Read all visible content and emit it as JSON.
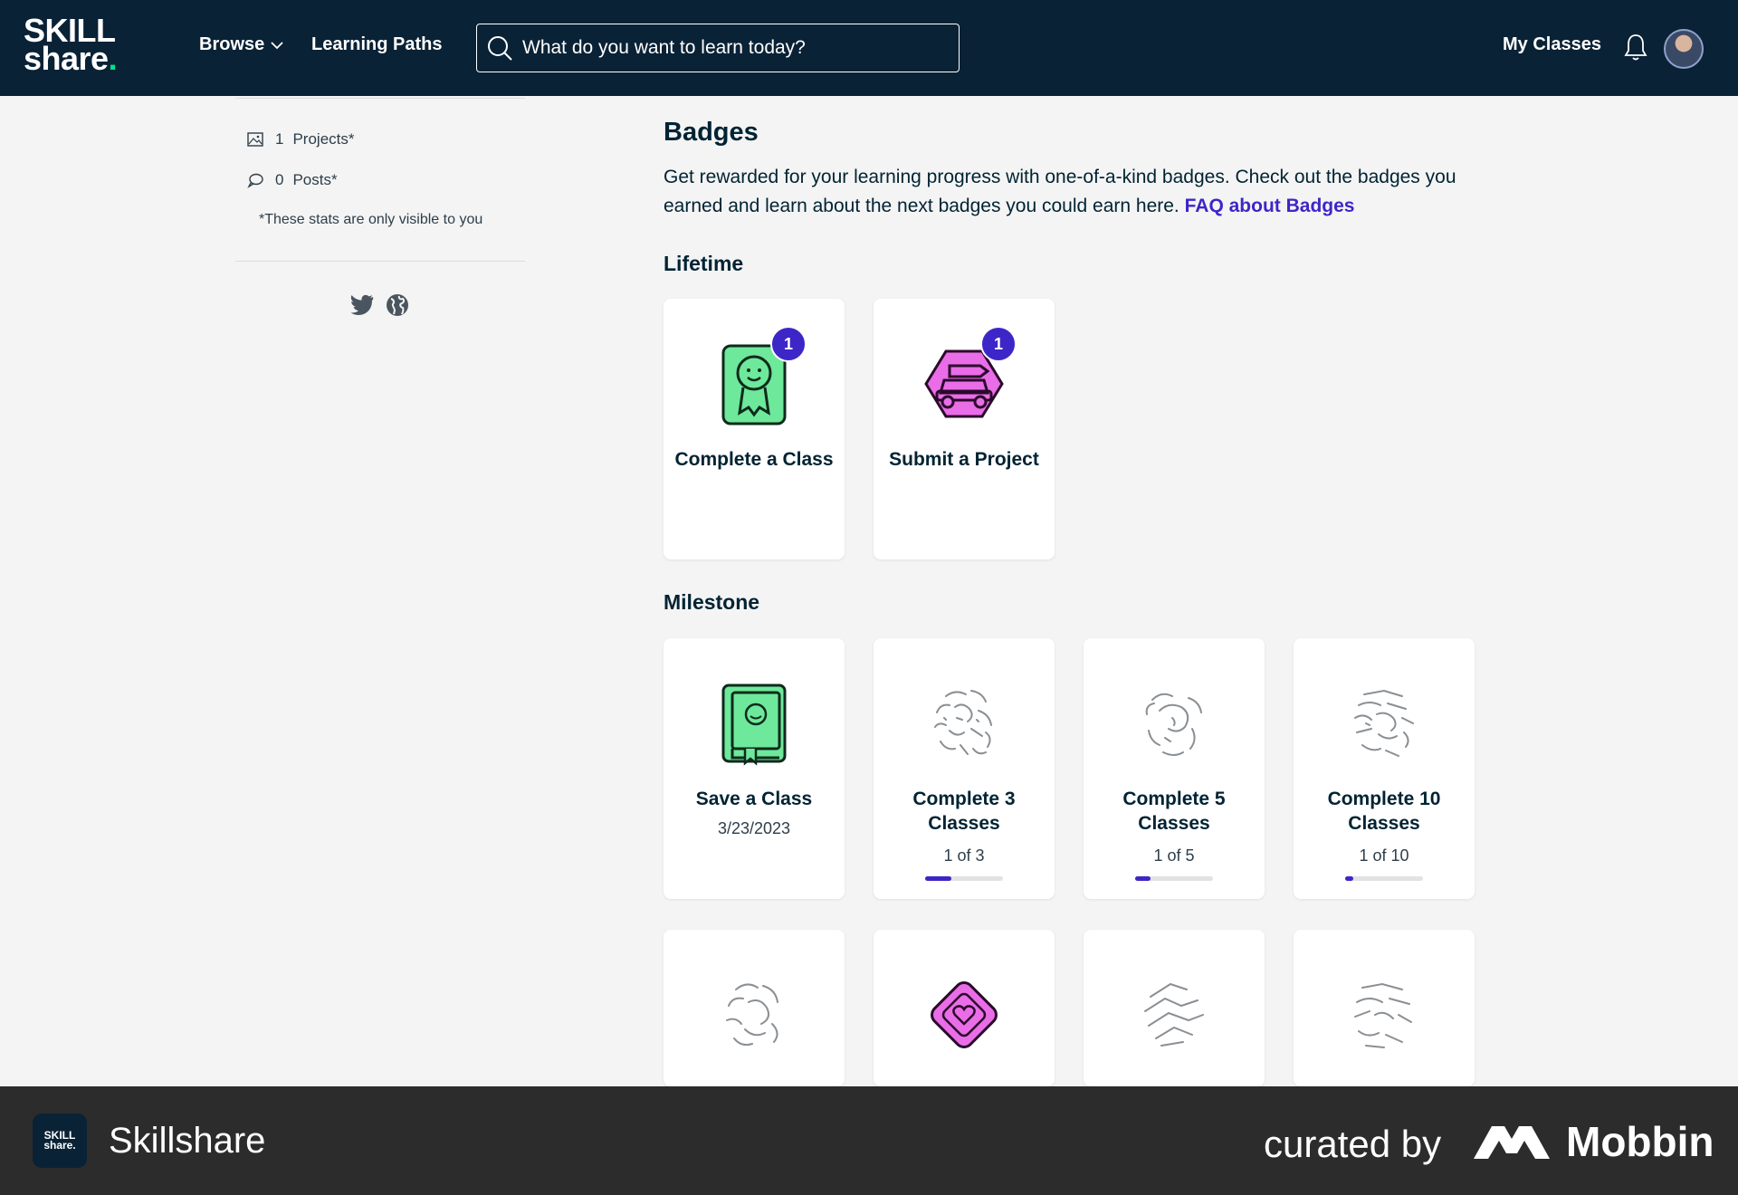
{
  "header": {
    "logo_line1": "SKILL",
    "logo_line2": "share",
    "logo_dot": ".",
    "browse_label": "Browse",
    "learning_paths_label": "Learning Paths",
    "search_placeholder": "What do you want to learn today?",
    "my_classes_label": "My Classes"
  },
  "sidebar": {
    "stats": [
      {
        "count": "1",
        "label": "Projects*"
      },
      {
        "count": "0",
        "label": "Posts*"
      }
    ],
    "note": "*These stats are only visible to you"
  },
  "badges": {
    "title": "Badges",
    "intro": "Get rewarded for your learning progress with one-of-a-kind badges. Check out the badges you earned and learn about the next badges you could earn here.",
    "faq_link": "FAQ about Badges",
    "lifetime": {
      "heading": "Lifetime",
      "cards": [
        {
          "title": "Complete a Class",
          "count": "1",
          "icon": "ribbon-award-icon"
        },
        {
          "title": "Submit a Project",
          "count": "1",
          "icon": "car-hexagon-icon"
        }
      ]
    },
    "milestone": {
      "heading": "Milestone",
      "cards": [
        {
          "title": "Save a Class",
          "sub": "3/23/2023",
          "icon": "book-icon"
        },
        {
          "title": "Complete 3 Classes",
          "sub": "1 of 3",
          "progress": 0.333,
          "icon": "locked-scribble-icon"
        },
        {
          "title": "Complete 5 Classes",
          "sub": "1 of 5",
          "progress": 0.2,
          "icon": "locked-scribble-icon"
        },
        {
          "title": "Complete 10 Classes",
          "sub": "1 of 10",
          "progress": 0.1,
          "icon": "locked-scribble-icon"
        }
      ],
      "row2_icons": [
        "locked-scribble-icon",
        "heart-diamond-icon",
        "locked-scribble-icon",
        "locked-scribble-icon"
      ]
    }
  },
  "colors": {
    "header_bg": "#0a2236",
    "accent": "#3d26c7",
    "brand_green": "#00e38c",
    "badge_green": "#6ee89a",
    "badge_pink": "#ea6de8"
  },
  "footer": {
    "app_name": "Skillshare",
    "curated_by": "curated by",
    "brand": "Mobbin",
    "logo_text": "SKILL share."
  }
}
